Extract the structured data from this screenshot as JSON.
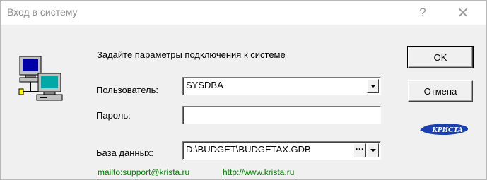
{
  "window": {
    "title": "Вход в систему",
    "help_glyph": "?",
    "close_glyph": "✕"
  },
  "dialog": {
    "prompt": "Задайте параметры подключения к системе",
    "user_label": "Пользователь:",
    "user_value": "SYSDBA",
    "password_label": "Пароль:",
    "password_value": "",
    "database_label": "База данных:",
    "database_value": "D:\\BUDGET\\BUDGETAX.GDB",
    "browse_label": "···"
  },
  "buttons": {
    "ok_label": "OK",
    "cancel_label": "Отмена"
  },
  "links": {
    "mail": "mailto:support@krista.ru",
    "web": "http://www.krista.ru"
  },
  "logo": {
    "text": "КРИСТА",
    "color": "#1a3fb0"
  },
  "icons": {
    "app": "networked-computers-icon",
    "logo": "krista-logo",
    "dropdown": "chevron-down-icon"
  },
  "colors": {
    "link": "#008000",
    "title_text": "#8e8e8e",
    "dialog_bg": "#f0f0f0"
  }
}
